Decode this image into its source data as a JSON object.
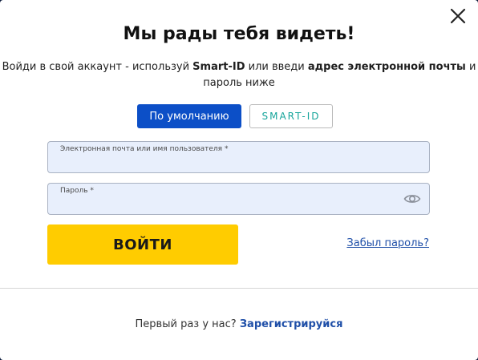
{
  "modal": {
    "close_icon": "close-icon",
    "title": "Мы рады тебя видеть!",
    "subtitle": {
      "part1": "Войди в свой аккаунт - используй ",
      "smartid_bold": "Smart-ID",
      "part2": " или введи ",
      "email_bold": "адрес электронной почты",
      "part3": " и пароль ниже"
    },
    "mode_buttons": {
      "default_label": "По умолчанию",
      "smartid_label": "SMART-ID"
    },
    "email_field": {
      "label": "Электронная почта или имя пользователя *",
      "value": ""
    },
    "password_field": {
      "label": "Пароль *",
      "value": "",
      "toggle_icon": "eye-icon"
    },
    "login_button": "ВОЙТИ",
    "forgot_password": "Забыл пароль?",
    "register": {
      "prompt": "Первый раз у нас? ",
      "link": "Зарегистрируйся"
    }
  },
  "colors": {
    "primary_blue": "#0c4fc7",
    "login_yellow": "#ffcc00",
    "smartid_teal": "#17a59b",
    "field_bg": "#e8effc",
    "link_blue": "#1f4fa8"
  }
}
